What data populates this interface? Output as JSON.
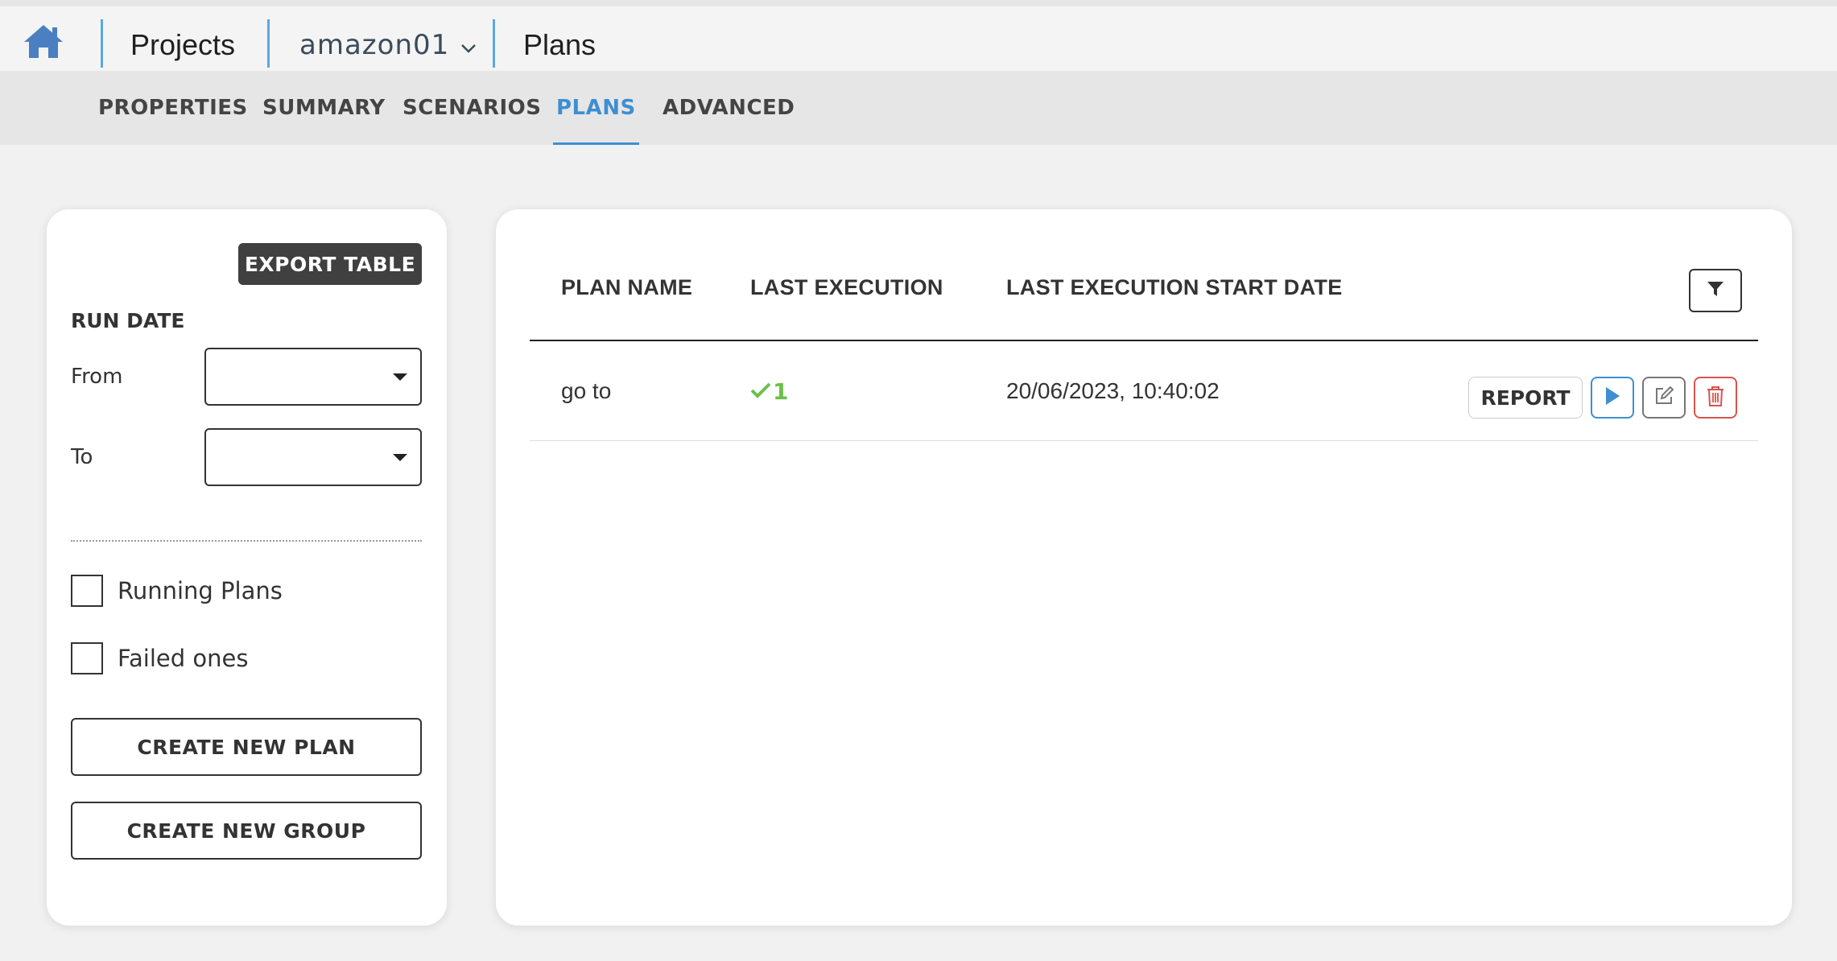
{
  "breadcrumb": {
    "projects_label": "Projects",
    "project_name": "amazon01",
    "page_label": "Plans"
  },
  "tabs": [
    {
      "label": "PROPERTIES",
      "active": false
    },
    {
      "label": "SUMMARY",
      "active": false
    },
    {
      "label": "SCENARIOS",
      "active": false
    },
    {
      "label": "PLANS",
      "active": true
    },
    {
      "label": "ADVANCED",
      "active": false
    }
  ],
  "filters": {
    "export_label": "EXPORT TABLE",
    "run_date_label": "RUN DATE",
    "from_label": "From",
    "to_label": "To",
    "from_value": "",
    "to_value": "",
    "running_plans_label": "Running Plans",
    "running_plans_checked": false,
    "failed_ones_label": "Failed ones",
    "failed_ones_checked": false,
    "create_plan_label": "CREATE NEW PLAN",
    "create_group_label": "CREATE NEW GROUP"
  },
  "table": {
    "columns": [
      "PLAN NAME",
      "LAST EXECUTION",
      "LAST EXECUTION START DATE"
    ],
    "rows": [
      {
        "plan_name": "go to",
        "last_execution_count": "1",
        "last_execution_status": "success",
        "start_date": "20/06/2023, 10:40:02",
        "report_label": "REPORT"
      }
    ]
  },
  "icons": {
    "home": "home-icon",
    "project_dropdown": "chevron-down-icon",
    "filter": "filter-icon",
    "success": "checkmark-icon",
    "play": "play-icon",
    "edit": "edit-icon",
    "delete": "trash-icon"
  },
  "colors": {
    "accent": "#3d8fd1",
    "success": "#6cc04a",
    "danger": "#d9534f",
    "home_icon": "#4a7fc1"
  }
}
